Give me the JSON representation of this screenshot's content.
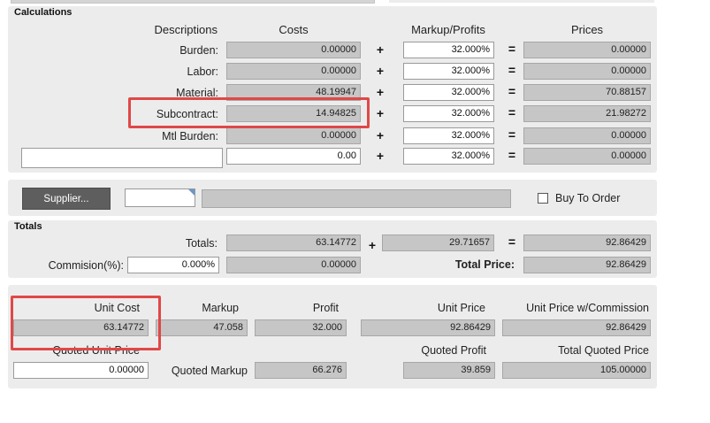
{
  "calculations": {
    "title": "Calculations",
    "headers": {
      "descriptions": "Descriptions",
      "costs": "Costs",
      "markup": "Markup/Profits",
      "prices": "Prices"
    },
    "rows": [
      {
        "label": "Burden:",
        "cost": "0.00000",
        "markup": "32.000%",
        "price": "0.00000"
      },
      {
        "label": "Labor:",
        "cost": "0.00000",
        "markup": "32.000%",
        "price": "0.00000"
      },
      {
        "label": "Material:",
        "cost": "48.19947",
        "markup": "32.000%",
        "price": "70.88157"
      },
      {
        "label": "Subcontract:",
        "cost": "14.94825",
        "markup": "32.000%",
        "price": "21.98272"
      },
      {
        "label": "Mtl Burden:",
        "cost": "0.00000",
        "markup": "32.000%",
        "price": "0.00000"
      }
    ],
    "misc_row": {
      "description": "",
      "cost": "0.00",
      "markup": "32.000%",
      "price": "0.00000"
    },
    "plus": "+",
    "equals": "="
  },
  "supplier": {
    "button_label": "Supplier...",
    "id_value": "",
    "name_value": "",
    "buy_to_order_label": "Buy To Order",
    "buy_to_order_checked": false
  },
  "totals": {
    "title": "Totals",
    "totals_label": "Totals:",
    "totals_cost": "63.14772",
    "totals_markup": "29.71657",
    "totals_price": "92.86429",
    "commission_label": "Commision(%):",
    "commission_value": "0.000%",
    "commission_amount": "0.00000",
    "total_price_label": "Total Price:",
    "total_price_value": "92.86429"
  },
  "unit": {
    "unit_cost_label": "Unit Cost",
    "unit_cost_value": "63.14772",
    "markup_label": "Markup",
    "markup_value": "47.058",
    "profit_label": "Profit",
    "profit_value": "32.000",
    "unit_price_label": "Unit Price",
    "unit_price_value": "92.86429",
    "unit_price_commission_label": "Unit Price w/Commission",
    "unit_price_commission_value": "92.86429",
    "quoted_unit_price_label": "Quoted Unit Price",
    "quoted_unit_price_value": "0.00000",
    "quoted_markup_label": "Quoted Markup",
    "quoted_markup_value": "66.276",
    "quoted_profit_label": "Quoted Profit",
    "quoted_profit_value": "39.859",
    "total_quoted_price_label": "Total Quoted Price",
    "total_quoted_price_value": "105.00000"
  },
  "colors": {
    "highlight_box": "#e04848",
    "panel": "#ececec",
    "readonly_field": "#c6c6c6",
    "button": "#5e5e5e"
  }
}
